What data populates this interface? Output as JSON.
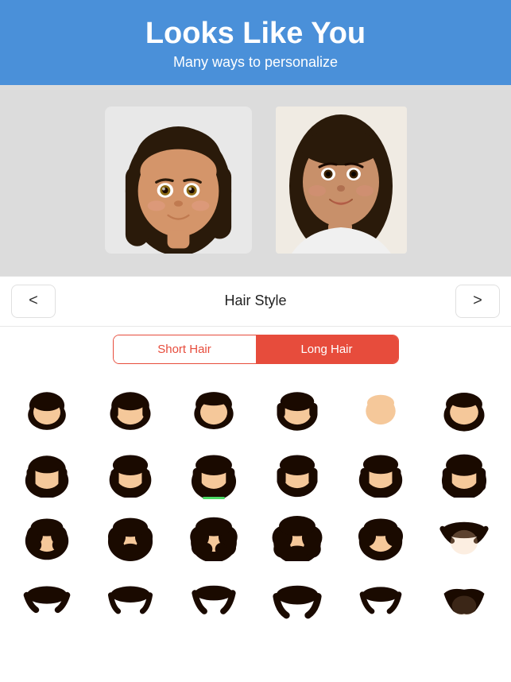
{
  "header": {
    "title": "Looks Like You",
    "subtitle": "Many ways to personalize"
  },
  "nav": {
    "prev_label": "<",
    "next_label": ">",
    "section_title": "Hair Style"
  },
  "segmented": {
    "short_label": "Short Hair",
    "long_label": "Long Hair",
    "active": "long"
  },
  "colors": {
    "header_bg": "#4A90D9",
    "active_seg": "#e74c3c",
    "inactive_seg": "#fff",
    "selected_indicator": "#4cd964"
  },
  "hair_rows": [
    {
      "row": 1,
      "count": 6
    },
    {
      "row": 2,
      "count": 6
    },
    {
      "row": 3,
      "count": 6
    }
  ]
}
